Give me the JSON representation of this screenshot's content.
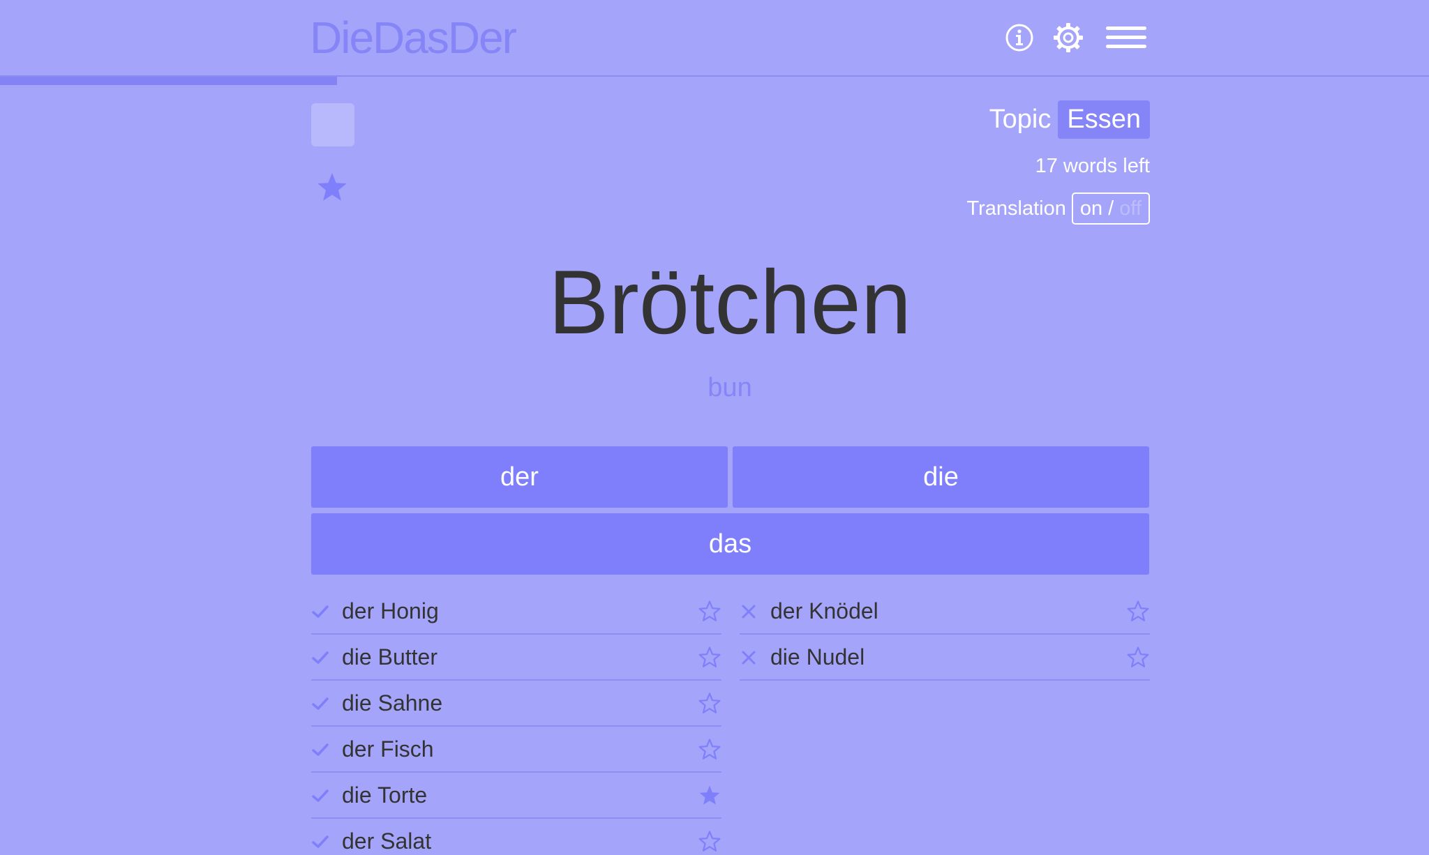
{
  "app": {
    "logo": "DieDasDer"
  },
  "progress": {
    "fraction": 0.236
  },
  "topic": {
    "label": "Topic",
    "value": "Essen"
  },
  "words_left": "17 words left",
  "translation_toggle": {
    "label": "Translation",
    "on": "on /",
    "off": "off",
    "state": "on"
  },
  "current": {
    "word": "Brötchen",
    "translation": "bun",
    "starred": true
  },
  "answers": {
    "der": "der",
    "die": "die",
    "das": "das"
  },
  "history": {
    "correct": [
      {
        "text": "der Honig",
        "starred": false
      },
      {
        "text": "die Butter",
        "starred": false
      },
      {
        "text": "die Sahne",
        "starred": false
      },
      {
        "text": "der Fisch",
        "starred": false
      },
      {
        "text": "die Torte",
        "starred": true
      },
      {
        "text": "der Salat",
        "starred": false
      }
    ],
    "wrong": [
      {
        "text": "der Knödel",
        "starred": false
      },
      {
        "text": "die Nudel",
        "starred": false
      }
    ]
  },
  "colors": {
    "background": "#a4a4fa",
    "accent": "#7f7ffb",
    "text_dark": "#333333",
    "text_light": "#ffffff"
  }
}
